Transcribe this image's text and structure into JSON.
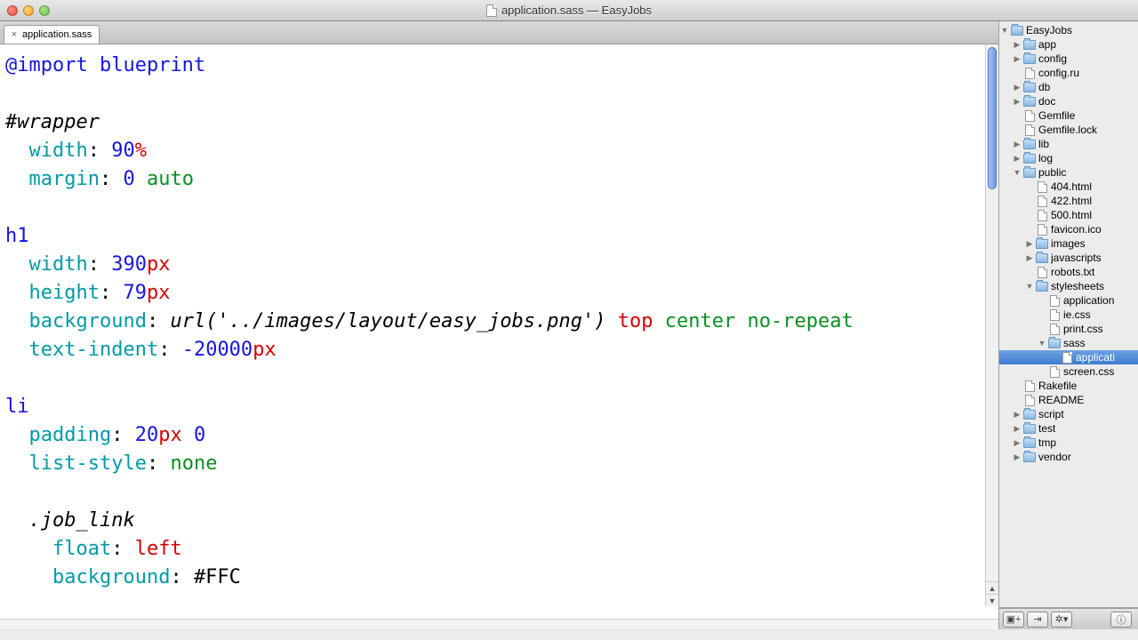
{
  "window": {
    "title": "application.sass — EasyJobs"
  },
  "tabs": [
    {
      "label": "application.sass"
    }
  ],
  "code": {
    "lines": [
      {
        "tokens": [
          {
            "t": "@import",
            "c": "kw"
          },
          {
            "t": " ",
            "c": ""
          },
          {
            "t": "blueprint",
            "c": "kw"
          }
        ]
      },
      {
        "tokens": []
      },
      {
        "tokens": [
          {
            "t": "#wrapper",
            "c": "sel"
          }
        ]
      },
      {
        "tokens": [
          {
            "t": "  ",
            "c": ""
          },
          {
            "t": "width",
            "c": "prop"
          },
          {
            "t": ": ",
            "c": ""
          },
          {
            "t": "90",
            "c": "num"
          },
          {
            "t": "%",
            "c": "unit"
          }
        ]
      },
      {
        "tokens": [
          {
            "t": "  ",
            "c": ""
          },
          {
            "t": "margin",
            "c": "prop"
          },
          {
            "t": ": ",
            "c": ""
          },
          {
            "t": "0",
            "c": "num"
          },
          {
            "t": " ",
            "c": ""
          },
          {
            "t": "auto",
            "c": "val"
          }
        ]
      },
      {
        "tokens": []
      },
      {
        "tokens": [
          {
            "t": "h1",
            "c": "kw"
          }
        ]
      },
      {
        "tokens": [
          {
            "t": "  ",
            "c": ""
          },
          {
            "t": "width",
            "c": "prop"
          },
          {
            "t": ": ",
            "c": ""
          },
          {
            "t": "390",
            "c": "num"
          },
          {
            "t": "px",
            "c": "unit"
          }
        ]
      },
      {
        "tokens": [
          {
            "t": "  ",
            "c": ""
          },
          {
            "t": "height",
            "c": "prop"
          },
          {
            "t": ": ",
            "c": ""
          },
          {
            "t": "79",
            "c": "num"
          },
          {
            "t": "px",
            "c": "unit"
          }
        ]
      },
      {
        "tokens": [
          {
            "t": "  ",
            "c": ""
          },
          {
            "t": "background",
            "c": "prop"
          },
          {
            "t": ": ",
            "c": ""
          },
          {
            "t": "url('../images/layout/easy_jobs.png')",
            "c": "str"
          },
          {
            "t": " ",
            "c": ""
          },
          {
            "t": "top",
            "c": "pos"
          },
          {
            "t": " ",
            "c": ""
          },
          {
            "t": "center",
            "c": "val"
          },
          {
            "t": " ",
            "c": ""
          },
          {
            "t": "no-repeat",
            "c": "val"
          }
        ]
      },
      {
        "tokens": [
          {
            "t": "  ",
            "c": ""
          },
          {
            "t": "text-indent",
            "c": "prop"
          },
          {
            "t": ": ",
            "c": ""
          },
          {
            "t": "-20000",
            "c": "num"
          },
          {
            "t": "px",
            "c": "unit"
          }
        ]
      },
      {
        "tokens": []
      },
      {
        "tokens": [
          {
            "t": "li",
            "c": "kw"
          }
        ]
      },
      {
        "tokens": [
          {
            "t": "  ",
            "c": ""
          },
          {
            "t": "padding",
            "c": "prop"
          },
          {
            "t": ": ",
            "c": ""
          },
          {
            "t": "20",
            "c": "num"
          },
          {
            "t": "px",
            "c": "unit"
          },
          {
            "t": " ",
            "c": ""
          },
          {
            "t": "0",
            "c": "num"
          }
        ]
      },
      {
        "tokens": [
          {
            "t": "  ",
            "c": ""
          },
          {
            "t": "list-style",
            "c": "prop"
          },
          {
            "t": ": ",
            "c": ""
          },
          {
            "t": "none",
            "c": "val"
          }
        ]
      },
      {
        "tokens": []
      },
      {
        "tokens": [
          {
            "t": "  ",
            "c": ""
          },
          {
            "t": ".job_link",
            "c": "sel"
          }
        ]
      },
      {
        "tokens": [
          {
            "t": "    ",
            "c": ""
          },
          {
            "t": "float",
            "c": "prop"
          },
          {
            "t": ": ",
            "c": ""
          },
          {
            "t": "left",
            "c": "pos"
          }
        ]
      },
      {
        "tokens": [
          {
            "t": "    ",
            "c": ""
          },
          {
            "t": "background",
            "c": "prop"
          },
          {
            "t": ": ",
            "c": ""
          },
          {
            "t": "#FFC",
            "c": "hex"
          }
        ]
      }
    ]
  },
  "tree": [
    {
      "d": 0,
      "exp": "open",
      "type": "folder",
      "label": "EasyJobs"
    },
    {
      "d": 1,
      "exp": "closed",
      "type": "folder",
      "label": "app"
    },
    {
      "d": 1,
      "exp": "closed",
      "type": "folder",
      "label": "config"
    },
    {
      "d": 1,
      "exp": "",
      "type": "file",
      "label": "config.ru"
    },
    {
      "d": 1,
      "exp": "closed",
      "type": "folder",
      "label": "db"
    },
    {
      "d": 1,
      "exp": "closed",
      "type": "folder",
      "label": "doc"
    },
    {
      "d": 1,
      "exp": "",
      "type": "file",
      "label": "Gemfile"
    },
    {
      "d": 1,
      "exp": "",
      "type": "file",
      "label": "Gemfile.lock"
    },
    {
      "d": 1,
      "exp": "closed",
      "type": "folder",
      "label": "lib"
    },
    {
      "d": 1,
      "exp": "closed",
      "type": "folder",
      "label": "log"
    },
    {
      "d": 1,
      "exp": "open",
      "type": "folder",
      "label": "public"
    },
    {
      "d": 2,
      "exp": "",
      "type": "file",
      "label": "404.html"
    },
    {
      "d": 2,
      "exp": "",
      "type": "file",
      "label": "422.html"
    },
    {
      "d": 2,
      "exp": "",
      "type": "file",
      "label": "500.html"
    },
    {
      "d": 2,
      "exp": "",
      "type": "file",
      "label": "favicon.ico"
    },
    {
      "d": 2,
      "exp": "closed",
      "type": "folder",
      "label": "images"
    },
    {
      "d": 2,
      "exp": "closed",
      "type": "folder",
      "label": "javascripts"
    },
    {
      "d": 2,
      "exp": "",
      "type": "file",
      "label": "robots.txt"
    },
    {
      "d": 2,
      "exp": "open",
      "type": "folder",
      "label": "stylesheets"
    },
    {
      "d": 3,
      "exp": "",
      "type": "file",
      "label": "application"
    },
    {
      "d": 3,
      "exp": "",
      "type": "file",
      "label": "ie.css"
    },
    {
      "d": 3,
      "exp": "",
      "type": "file",
      "label": "print.css"
    },
    {
      "d": 3,
      "exp": "open",
      "type": "folder",
      "label": "sass"
    },
    {
      "d": 4,
      "exp": "",
      "type": "file",
      "label": "applicati",
      "sel": true
    },
    {
      "d": 3,
      "exp": "",
      "type": "file",
      "label": "screen.css"
    },
    {
      "d": 1,
      "exp": "",
      "type": "file",
      "label": "Rakefile"
    },
    {
      "d": 1,
      "exp": "",
      "type": "file",
      "label": "README"
    },
    {
      "d": 1,
      "exp": "closed",
      "type": "folder",
      "label": "script"
    },
    {
      "d": 1,
      "exp": "closed",
      "type": "folder",
      "label": "test"
    },
    {
      "d": 1,
      "exp": "closed",
      "type": "folder",
      "label": "tmp"
    },
    {
      "d": 1,
      "exp": "closed",
      "type": "folder",
      "label": "vendor"
    }
  ],
  "toolbar": {
    "b1": "▣+",
    "b2": "⇥",
    "b3": "✲",
    "b4": "ⓘ"
  }
}
